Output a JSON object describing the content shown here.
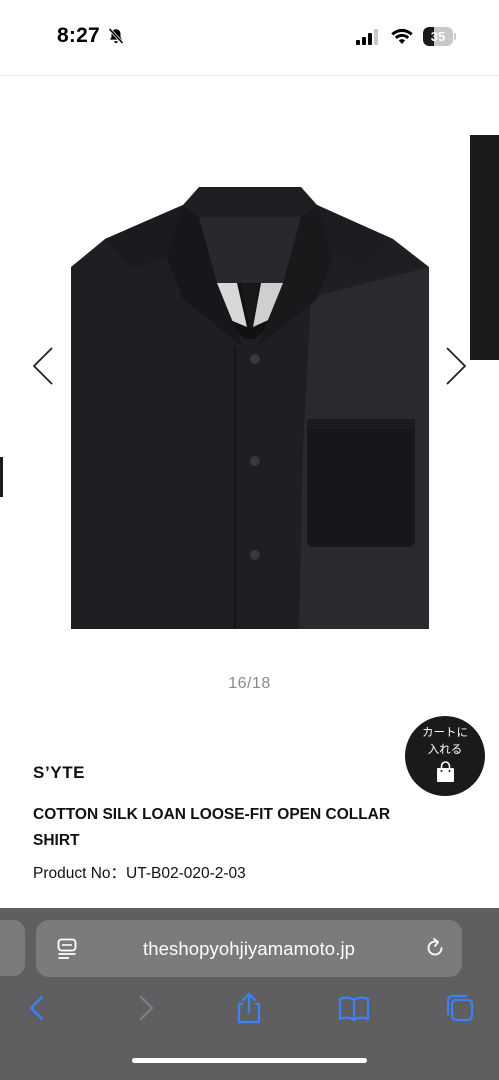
{
  "status_bar": {
    "time": "8:27",
    "battery_percent": "35",
    "battery_level": 0.35,
    "icons": [
      "bell-slash-icon",
      "cellular-signal-icon",
      "wifi-icon",
      "battery-icon"
    ]
  },
  "carousel": {
    "counter": "16/18",
    "current": 16,
    "total": 18,
    "prev_icon": "chevron-left-icon",
    "next_icon": "chevron-right-icon"
  },
  "product": {
    "brand": "S’YTE",
    "title": "COTTON SILK LOAN LOOSE-FIT OPEN COLLAR SHIRT",
    "product_no": "Product No：UT-B02-020-2-03"
  },
  "cart_button": {
    "line1": "カートに",
    "line2": "入れる",
    "icon": "shopping-bag-icon"
  },
  "browser": {
    "url": "theshopyohjiyamamoto.jp",
    "toolbar": [
      "back-icon",
      "forward-icon",
      "share-icon",
      "bookmarks-icon",
      "tabs-icon"
    ]
  },
  "colors": {
    "shirt": "#1f1d21",
    "browser_chrome": "#5f5f61",
    "address_bar": "#7b7b7e",
    "toolbar_icon": "#3a82f7",
    "cart_button": "#1a1a1a"
  }
}
